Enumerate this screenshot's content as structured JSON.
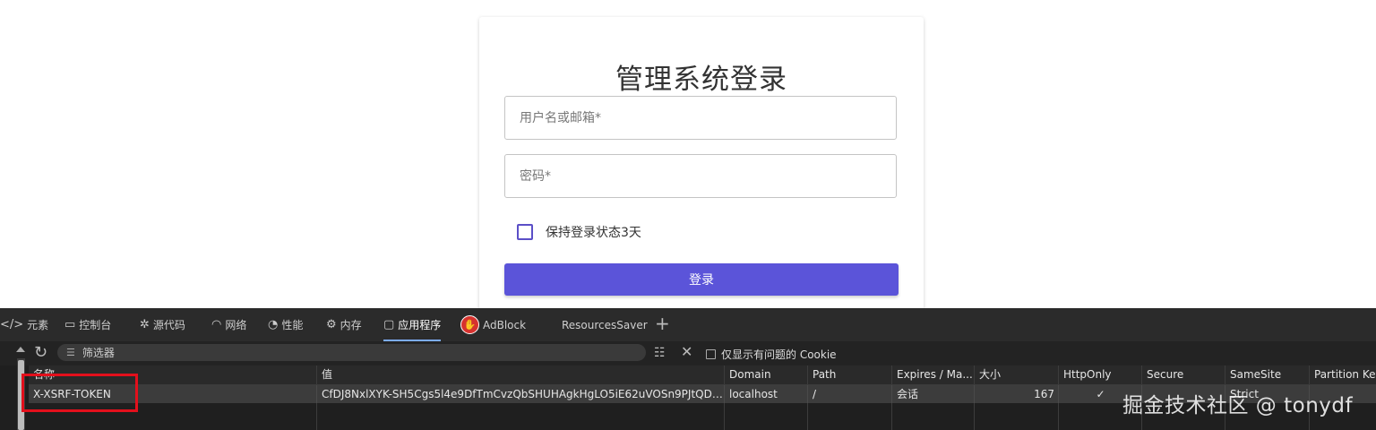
{
  "login": {
    "title": "管理系统登录",
    "username_placeholder": "用户名或邮箱*",
    "username_value": "",
    "password_placeholder": "密码*",
    "password_value": "",
    "remember_label": "保持登录状态3天",
    "remember_checked": false,
    "submit_label": "登录",
    "accent_color": "#5b54d9"
  },
  "devtools": {
    "tabs": [
      {
        "label": "元素",
        "icon": "code-brackets-icon"
      },
      {
        "label": "控制台",
        "icon": "console-icon"
      },
      {
        "label": "源代码",
        "icon": "bug-icon"
      },
      {
        "label": "网络",
        "icon": "wifi-icon"
      },
      {
        "label": "性能",
        "icon": "gauge-icon"
      },
      {
        "label": "内存",
        "icon": "memory-icon"
      },
      {
        "label": "应用程序",
        "icon": "window-icon",
        "active": true
      },
      {
        "label": "AdBlock",
        "icon": "adblock-hand-icon"
      },
      {
        "label": "ResourcesSaver",
        "icon": ""
      }
    ],
    "filter_placeholder": "筛选器",
    "only_issues_label": "仅显示有问题的 Cookie",
    "table": {
      "columns": [
        "名称",
        "值",
        "Domain",
        "Path",
        "Expires / Ma...",
        "大小",
        "HttpOnly",
        "Secure",
        "SameSite",
        "Partition Key"
      ],
      "rows": [
        {
          "name": "X-XSRF-TOKEN",
          "value": "CfDJ8NxlXYK-SH5Cgs5l4e9DfTmCvzQbSHUHAgkHgLO5iE62uVOSn9PJtQDE...",
          "domain": "localhost",
          "path": "/",
          "expires": "会话",
          "size": "167",
          "httponly": "✓",
          "secure": "",
          "samesite": "Strict",
          "partition_key": ""
        }
      ]
    }
  },
  "watermark": "掘金技术社区 @ tonydf"
}
